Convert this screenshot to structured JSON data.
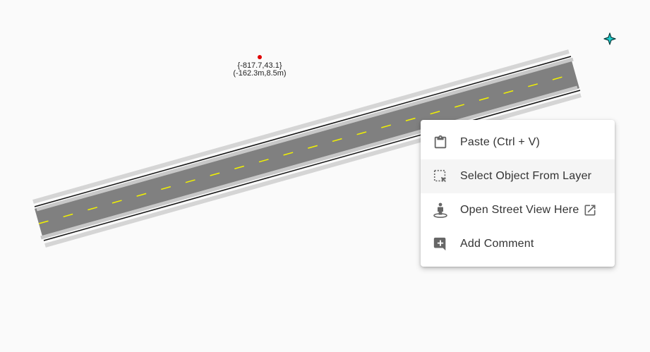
{
  "map": {
    "cursor": {
      "coordinates": "{-817.7,43.1}",
      "offset": "(-162.3m,8.5m)"
    },
    "colors": {
      "background": "#fafafa",
      "road_surface": "#808080",
      "shoulder": "#d5d5d5",
      "edge_line": "#111111",
      "center_line": "#f2f200",
      "cursor_point": "#e00000",
      "compass": "#1fd1d1"
    },
    "compass_icon": "compass-star-icon"
  },
  "context_menu": {
    "items": [
      {
        "label": "Paste (Ctrl + V)",
        "icon": "clipboard-icon",
        "hovered": false
      },
      {
        "label": "Select Object From Layer",
        "icon": "select-region-icon",
        "hovered": true
      },
      {
        "label": "Open Street View Here",
        "icon": "street-view-person-icon",
        "external": "open-in-new-icon",
        "hovered": false
      },
      {
        "label": "Add Comment",
        "icon": "add-comment-icon",
        "hovered": false
      }
    ]
  }
}
